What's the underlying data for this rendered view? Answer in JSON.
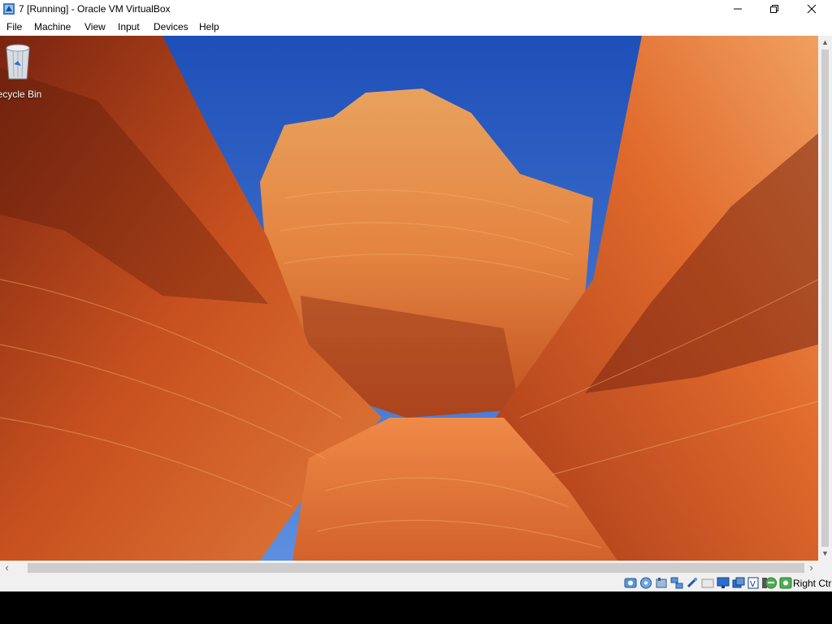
{
  "window": {
    "title": "7 [Running] - Oracle VM VirtualBox",
    "minimize_icon": "minimize-icon",
    "maximize_icon": "restore-icon",
    "close_icon": "close-icon"
  },
  "menu": {
    "items": [
      {
        "label": "File"
      },
      {
        "label": "Machine"
      },
      {
        "label": "View"
      },
      {
        "label": "Input"
      },
      {
        "label": "Devices"
      },
      {
        "label": "Help"
      }
    ]
  },
  "desktop": {
    "icons": [
      {
        "label": "Recycle Bin",
        "icon": "recycle-bin-icon"
      }
    ],
    "wallpaper": "sandstone canyon (The Wave)"
  },
  "statusbar": {
    "icons": [
      "hard-disk-icon",
      "optical-drive-icon",
      "audio-icon",
      "network-icon",
      "usb-icon",
      "shared-folders-icon",
      "display-icon",
      "video-capture-icon",
      "recording-icon",
      "cpu-icon",
      "mouse-integration-icon",
      "keyboard-icon"
    ],
    "host_key": "Right Ctrl"
  },
  "colors": {
    "sky": "#2a5fc4",
    "rock": "#c8511f",
    "chrome": "#f0f0f0",
    "scroll_thumb": "#cdcdcd"
  }
}
